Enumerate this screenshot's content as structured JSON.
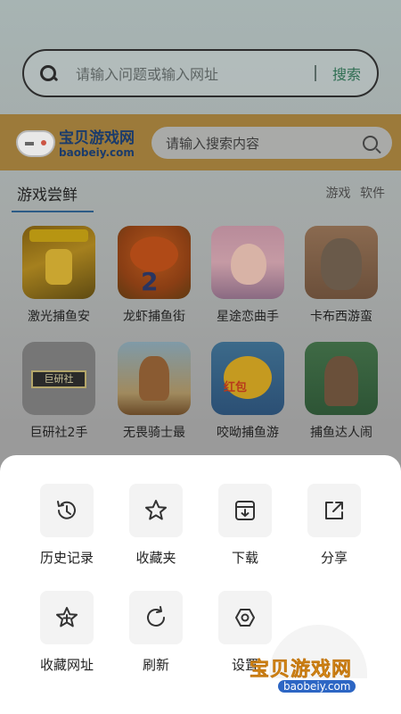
{
  "search": {
    "placeholder": "请输入问题或输入网址",
    "button": "搜索"
  },
  "banner": {
    "logo_name": "宝贝游戏网",
    "logo_domain": "baobeiy.com",
    "search_placeholder": "请输入搜索内容"
  },
  "section": {
    "title": "游戏尝鲜",
    "tabs": [
      "游戏",
      "软件"
    ]
  },
  "games": [
    {
      "label": "激光捕鱼安",
      "icon": "fishing-game-icon"
    },
    {
      "label": "龙虾捕鱼街",
      "icon": "lobster-fish-icon"
    },
    {
      "label": "星途恋曲手",
      "icon": "anime-girl-icon"
    },
    {
      "label": "卡布西游蛮",
      "icon": "bearded-man-icon"
    },
    {
      "label": "巨研社2手",
      "icon": "plate-sign-icon"
    },
    {
      "label": "无畏骑士最",
      "icon": "warrior-icon"
    },
    {
      "label": "咬呦捕鱼游",
      "icon": "golden-fish-icon"
    },
    {
      "label": "捕鱼达人闹",
      "icon": "fisherman-icon"
    }
  ],
  "game_icon_texts": {
    "ic2_num": "2",
    "ic5_plate": "巨研社",
    "ic7_tag": "红包"
  },
  "sheet": {
    "actions": [
      {
        "label": "历史记录",
        "icon": "history-icon"
      },
      {
        "label": "收藏夹",
        "icon": "star-icon"
      },
      {
        "label": "下载",
        "icon": "download-icon"
      },
      {
        "label": "分享",
        "icon": "share-icon"
      },
      {
        "label": "收藏网址",
        "icon": "star-plus-icon"
      },
      {
        "label": "刷新",
        "icon": "refresh-icon"
      },
      {
        "label": "设置",
        "icon": "settings-icon"
      }
    ]
  },
  "watermark": {
    "text": "宝贝游戏网",
    "domain": "baobeiy.com"
  },
  "colors": {
    "accent": "#2f6e52",
    "banner": "#9c7a3a",
    "sheet": "#ffffff"
  }
}
